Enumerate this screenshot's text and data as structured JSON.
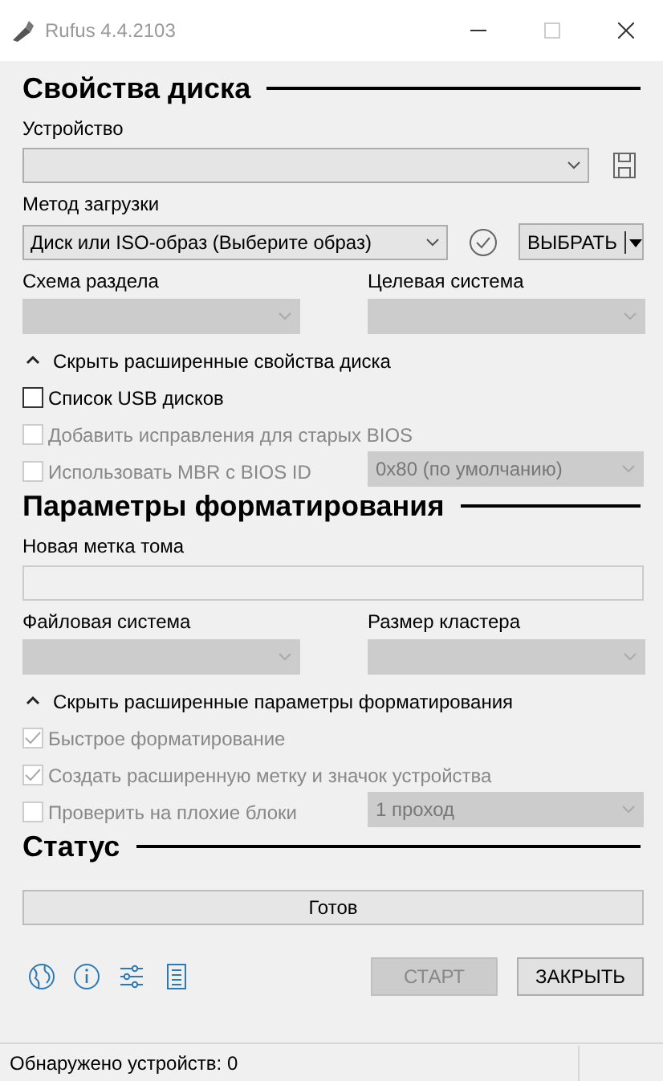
{
  "window": {
    "title": "Rufus 4.4.2103"
  },
  "sections": [
    {
      "heading": "Свойства диска",
      "rows": [
        {
          "kind": "select_field",
          "label": "Устройство",
          "disabled": false,
          "side_icon": {
            "kind": "save"
          }
        },
        {
          "kind": "select_field",
          "label": "Метод загрузки",
          "value": "Диск или ISO-образ (Выберите образ)",
          "disabled": false,
          "side_icon": {
            "kind": "check"
          },
          "button": "ВЫБРАТЬ"
        },
        {
          "kind": "pair",
          "fields": [
            {
              "label": "Схема раздела",
              "disabled": true
            },
            {
              "label": "Целевая система",
              "disabled": true
            }
          ]
        },
        {
          "kind": "toggle",
          "label": "Скрыть расширенные свойства диска",
          "expanded": true
        },
        {
          "kind": "checkbox",
          "label": "Список USB дисков",
          "checked": false,
          "disabled": false
        },
        {
          "kind": "checkbox",
          "label": "Добавить исправления для старых BIOS",
          "checked": false,
          "disabled": true
        },
        {
          "kind": "checkbox",
          "label": "Использовать MBR с BIOS ID",
          "checked": false,
          "disabled": true,
          "select": {
            "value": "0x80 (по умолчанию)",
            "disabled": true
          }
        }
      ]
    },
    {
      "heading": "Параметры форматирования",
      "rows": [
        {
          "kind": "input_field",
          "label": "Новая метка тома",
          "disabled": true
        },
        {
          "kind": "pair",
          "fields": [
            {
              "label": "Файловая система",
              "disabled": true
            },
            {
              "label": "Размер кластера",
              "disabled": true
            }
          ]
        },
        {
          "kind": "toggle",
          "label": "Скрыть расширенные параметры форматирования",
          "expanded": true
        },
        {
          "kind": "checkbox",
          "label": "Быстрое форматирование",
          "checked": true,
          "disabled": true
        },
        {
          "kind": "checkbox",
          "label": "Создать расширенную метку и значок устройства",
          "checked": true,
          "disabled": true
        },
        {
          "kind": "checkbox",
          "label": "Проверить на плохие блоки",
          "checked": false,
          "disabled": true,
          "select": {
            "value": "1 проход",
            "disabled": true
          }
        }
      ]
    },
    {
      "heading": "Статус",
      "rows": [
        {
          "kind": "progress",
          "text": "Готов"
        }
      ]
    }
  ],
  "toolbar": {
    "icons": [
      {
        "kind": "globe"
      },
      {
        "kind": "info"
      },
      {
        "kind": "settings"
      },
      {
        "kind": "log"
      }
    ],
    "buttons": [
      {
        "label": "СТАРТ",
        "disabled": true
      },
      {
        "label": "ЗАКРЫТЬ",
        "disabled": false
      }
    ]
  },
  "status_bar": {
    "text": "Обнаружено устройств: 0"
  }
}
